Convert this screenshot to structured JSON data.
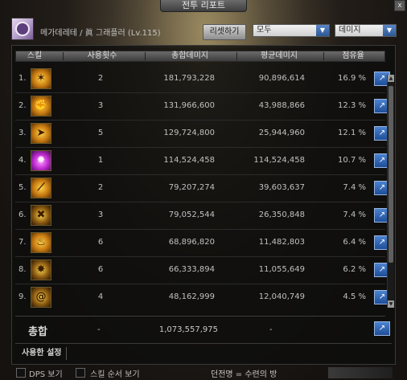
{
  "window": {
    "title": "전투 리포트",
    "close": "x"
  },
  "header": {
    "character_name": "메가데레테 / 眞 그래플러 (Lv.115)",
    "reset_label": "리셋하기",
    "filter_select": "모두",
    "metric_select": "데미지"
  },
  "table": {
    "columns": [
      "스킬",
      "사용횟수",
      "총합데미지",
      "평균데미지",
      "점유율"
    ],
    "rows": [
      {
        "rank": "1.",
        "icon": "sparkle-strike-icon",
        "count": "2",
        "total": "181,793,228",
        "avg": "90,896,614",
        "share": "16.9 %"
      },
      {
        "rank": "2.",
        "icon": "grab-throw-icon",
        "count": "3",
        "total": "131,966,600",
        "avg": "43,988,866",
        "share": "12.3 %"
      },
      {
        "rank": "3.",
        "icon": "rush-claw-icon",
        "count": "5",
        "total": "129,724,800",
        "avg": "25,944,960",
        "share": "12.1 %"
      },
      {
        "rank": "4.",
        "icon": "purple-burst-icon",
        "count": "1",
        "total": "114,524,458",
        "avg": "114,524,458",
        "share": "10.7 %"
      },
      {
        "rank": "5.",
        "icon": "slash-kick-icon",
        "count": "2",
        "total": "79,207,274",
        "avg": "39,603,637",
        "share": "7.4 %"
      },
      {
        "rank": "6.",
        "icon": "suplex-icon",
        "count": "3",
        "total": "79,052,544",
        "avg": "26,350,848",
        "share": "7.4 %"
      },
      {
        "rank": "7.",
        "icon": "flame-hold-icon",
        "count": "6",
        "total": "68,896,820",
        "avg": "11,482,803",
        "share": "6.4 %"
      },
      {
        "rank": "8.",
        "icon": "explosion-icon",
        "count": "6",
        "total": "66,333,894",
        "avg": "11,055,649",
        "share": "6.2 %"
      },
      {
        "rank": "9.",
        "icon": "swirl-icon",
        "count": "4",
        "total": "48,162,999",
        "avg": "12,040,749",
        "share": "4.5 %"
      }
    ]
  },
  "summary": {
    "label": "총합",
    "count": "-",
    "total": "1,073,557,975",
    "avg": "-"
  },
  "tabs": {
    "used_settings": "사용한 설정"
  },
  "footer": {
    "dps_label": "DPS 보기",
    "order_label": "스킬 순서 보기",
    "dungeon": "던전명 = 수련의 방"
  }
}
